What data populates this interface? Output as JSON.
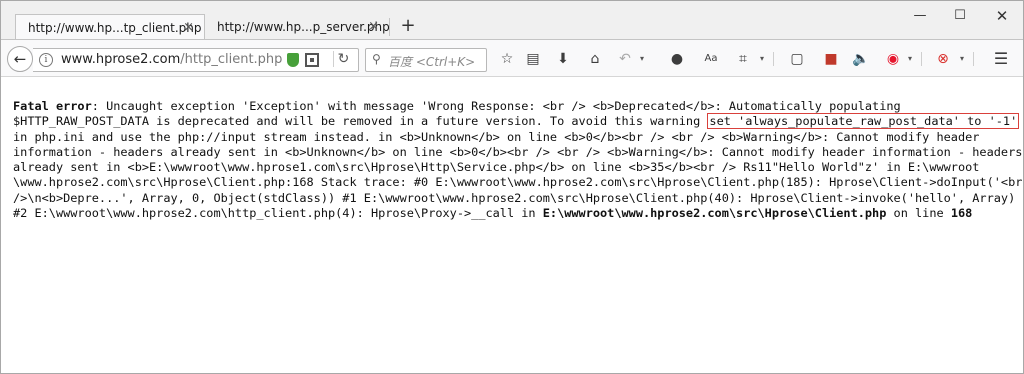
{
  "tabs": [
    {
      "label": "http://www.hp...tp_client.php",
      "close": "×"
    },
    {
      "label": "http://www.hp...p_server.php",
      "close": "×"
    }
  ],
  "new_tab": "+",
  "window_controls": {
    "minimize": "—",
    "maximize": "☐",
    "close": "✕"
  },
  "nav": {
    "back": "←",
    "url_host": "www.hprose2.com",
    "url_path": "/http_client.php",
    "search_placeholder": "百度 <Ctrl+K>",
    "reload": "↻"
  },
  "toolbar_icons": [
    "star-icon",
    "reading-list-icon",
    "download-icon",
    "home-icon",
    "undo-icon",
    "chat-icon",
    "reader-icon",
    "screenshot-icon",
    "screenshot-dropdown",
    "page-icon",
    "record-icon",
    "volume-icon",
    "weibo-icon",
    "weibo-dropdown",
    "block-icon",
    "block-dropdown",
    "menu-icon"
  ],
  "error": {
    "heading": "Fatal error",
    "lines": [
      ": Uncaught exception 'Exception' with message 'Wrong Response: <br /> <b>Deprecated</b>: Automatically populating",
      "$HTTP_RAW_POST_DATA is deprecated and will be removed in a future version. To avoid this warning ",
      "in php.ini and use the php://input stream instead. in <b>Unknown</b> on line <b>0</b><br /> <br /> <b>Warning</b>: Cannot modify header",
      "information - headers already sent in <b>Unknown</b> on line <b>0</b><br /> <br /> <b>Warning</b>: Cannot modify header information - headers",
      "already sent in <b>E:\\wwwroot\\www.hprose1.com\\src\\Hprose\\Http\\Service.php</b> on line <b>35</b><br /> Rs11\"Hello World\"z' in E:\\wwwroot",
      "\\www.hprose2.com\\src\\Hprose\\Client.php:168 Stack trace: #0 E:\\wwwroot\\www.hprose2.com\\src\\Hprose\\Client.php(185): Hprose\\Client->doInput('<br",
      "/>\\n<b>Depre...', Array, 0, Object(stdClass)) #1 E:\\wwwroot\\www.hprose2.com\\src\\Hprose\\Client.php(40): Hprose\\Client->invoke('hello', Array)",
      "#2 E:\\wwwroot\\www.hprose2.com\\http_client.php(4): Hprose\\Proxy->__call in "
    ],
    "highlighted": "set 'always_populate_raw_post_data' to '-1'",
    "file_bold": "E:\\wwwroot\\www.hprose2.com\\src\\Hprose\\Client.php",
    "on_line": " on line ",
    "line_number": "168"
  }
}
